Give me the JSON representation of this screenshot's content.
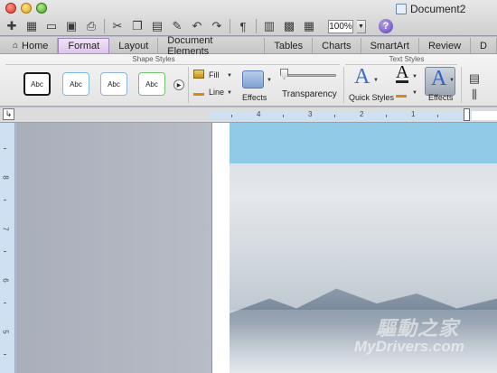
{
  "window": {
    "title": "Document2"
  },
  "toolbar": {
    "zoom": "100%"
  },
  "tabs": [
    "Home",
    "Format",
    "Layout",
    "Document Elements",
    "Tables",
    "Charts",
    "SmartArt",
    "Review",
    "D"
  ],
  "active_tab": "Format",
  "ribbon": {
    "shape_styles_label": "Shape Styles",
    "text_styles_label": "Text Styles",
    "swatches": [
      "Abc",
      "Abc",
      "Abc",
      "Abc"
    ],
    "fill_label": "Fill",
    "line_label": "Line",
    "effects_label": "Effects",
    "transparency_label": "Transparency",
    "quick_styles_label": "Quick Styles",
    "text_effects_label": "Effects"
  },
  "ruler": {
    "marks": [
      "4",
      "3",
      "2",
      "1"
    ]
  },
  "vruler": {
    "marks": [
      "8",
      "7",
      "6",
      "5"
    ]
  },
  "watermark": {
    "line1": "驅動之家",
    "line2": "MyDrivers.com"
  },
  "colors": {
    "active_tab": "#dcc6ea",
    "hero_band": "#8fcbe7",
    "swatch_border_black": "#1a1a1a",
    "swatch_border_blue1": "#7ab8e6",
    "swatch_border_blue2": "#8db3e0",
    "swatch_border_green": "#72c46b"
  }
}
